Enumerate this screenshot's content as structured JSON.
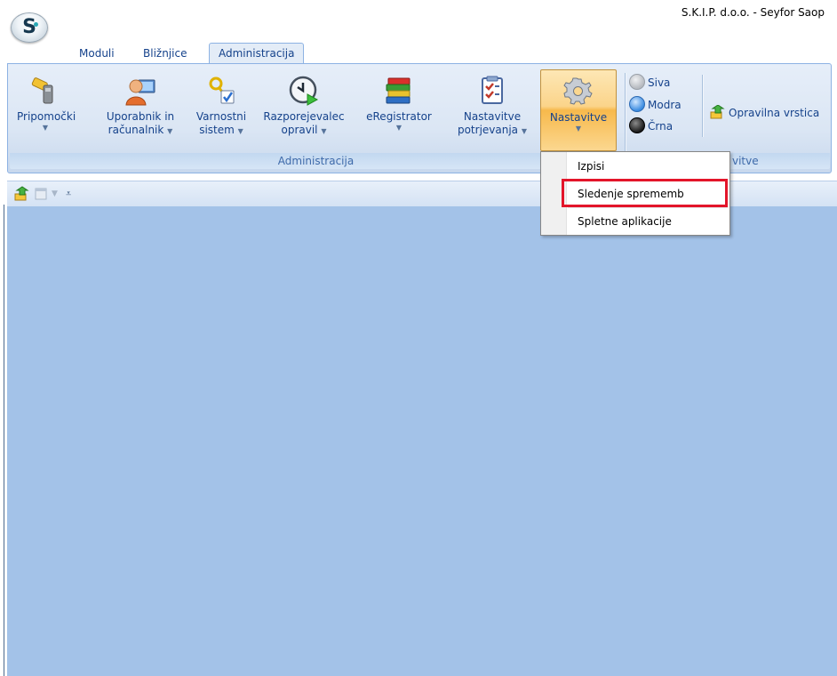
{
  "window": {
    "title": "S.K.I.P.  d.o.o. - Seyfor Saop",
    "orb_letter": "S"
  },
  "tabs": [
    {
      "label": "Moduli",
      "active": false
    },
    {
      "label": "Bližnjice",
      "active": false
    },
    {
      "label": "Administracija",
      "active": true
    }
  ],
  "ribbon": {
    "group_administracija": {
      "label": "Administracija",
      "buttons": [
        {
          "line1": "Pripomočki",
          "line2": "",
          "icon": "tools-icon"
        },
        {
          "line1": "Uporabnik in",
          "line2": "računalnik",
          "icon": "user-computer-icon"
        },
        {
          "line1": "Varnostni",
          "line2": "sistem",
          "icon": "security-keys-icon"
        },
        {
          "line1": "Razporejevalec",
          "line2": "opravil",
          "icon": "scheduler-clock-icon"
        },
        {
          "line1": "eRegistrator",
          "line2": "",
          "icon": "books-icon"
        },
        {
          "line1": "Nastavitve",
          "line2": "potrjevanja",
          "icon": "checklist-icon"
        },
        {
          "line1": "Nastavitve",
          "line2": "",
          "icon": "gear-icon"
        }
      ]
    },
    "group_nastavitve": {
      "label": "vitve",
      "themes": [
        {
          "label": "Siva",
          "color": "#b5b9bf"
        },
        {
          "label": "Modra",
          "color": "#3a8be0"
        },
        {
          "label": "Črna",
          "color": "#1a1a1a"
        }
      ],
      "taskbar_button": "Opravilna vrstica"
    }
  },
  "dropdown": {
    "items": [
      "Izpisi",
      "Sledenje sprememb",
      "Spletne aplikacije"
    ],
    "highlighted": "Sledenje sprememb"
  },
  "colors": {
    "workspace": "#a3c2e8",
    "highlight": "#e3152a",
    "ribbon_text": "#15428b"
  }
}
